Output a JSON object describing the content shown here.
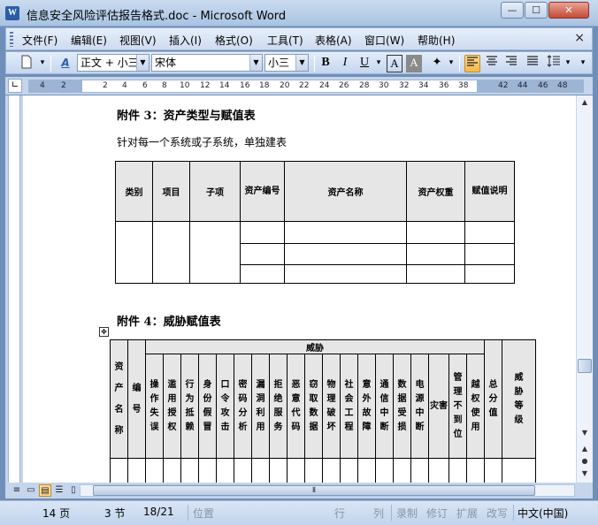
{
  "window": {
    "icon_letter": "W",
    "title": "信息安全风险评估报告格式.doc - Microsoft Word",
    "minimize": "—",
    "maximize": "☐",
    "close": "✕"
  },
  "menu": {
    "items": [
      "文件(F)",
      "编辑(E)",
      "视图(V)",
      "插入(I)",
      "格式(O)",
      "工具(T)",
      "表格(A)",
      "窗口(W)",
      "帮助(H)"
    ],
    "close_doc": "×"
  },
  "toolbar": {
    "style_combo": "正文 + 小三",
    "font_combo": "宋体",
    "size_combo": "小三",
    "bold": "B",
    "italic": "I",
    "underline": "U",
    "char_border": "A",
    "char_shading": "A",
    "styles_icon": "A"
  },
  "ruler": {
    "ticks": [
      "4",
      "2",
      "2",
      "4",
      "6",
      "8",
      "10",
      "12",
      "14",
      "16",
      "18",
      "20",
      "22",
      "24",
      "26",
      "28",
      "30",
      "32",
      "34",
      "36",
      "38",
      "42",
      "44",
      "46",
      "48"
    ]
  },
  "document": {
    "heading3": "附件 3：资产类型与赋值表",
    "intro": "针对每一个系统或子系统，单独建表",
    "asset_table": {
      "headers": [
        "类别",
        "项目",
        "子项",
        "资产编号",
        "资产名称",
        "资产权重",
        "赋值说明"
      ]
    },
    "heading4": "附件 4：威胁赋值表",
    "threat_table": {
      "group_header": "威胁",
      "col_asset_name": "资产名称",
      "col_id": "编号",
      "threats": [
        "操作失误",
        "滥用授权",
        "行为抵赖",
        "身份假冒",
        "口令攻击",
        "密码分析",
        "漏洞利用",
        "拒绝服务",
        "恶意代码",
        "窃取数据",
        "物理破坏",
        "社会工程",
        "意外故障",
        "通信中断",
        "数据受损",
        "电源中断",
        "灾害",
        "管理不到位",
        "越权使用"
      ],
      "col_total": "总分值",
      "col_level": "威胁等级"
    }
  },
  "statusbar": {
    "page": "14 页",
    "section": "3 节",
    "page_of": "18/21",
    "position": "位置",
    "line": "行",
    "column": "列",
    "record": "录制",
    "revise": "修订",
    "extend": "扩展",
    "overtype": "改写",
    "language": "中文(中国)"
  }
}
